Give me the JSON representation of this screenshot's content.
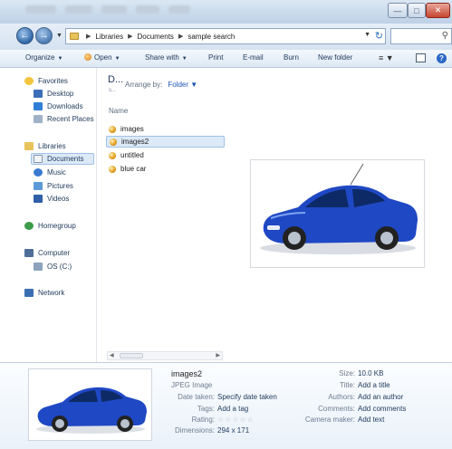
{
  "window": {
    "minimize_glyph": "—",
    "maximize_glyph": "□",
    "close_glyph": "✕"
  },
  "address": {
    "crumbs": [
      "Libraries",
      "Documents",
      "sample search"
    ],
    "search_placeholder": ""
  },
  "commands": {
    "organize": "Organize",
    "open": "Open",
    "share_with": "Share with",
    "print": "Print",
    "email": "E-mail",
    "burn": "Burn",
    "new_folder": "New folder"
  },
  "sidebar": {
    "favorites": {
      "label": "Favorites",
      "items": [
        "Desktop",
        "Downloads",
        "Recent Places"
      ]
    },
    "libraries": {
      "label": "Libraries",
      "items": [
        "Documents",
        "Music",
        "Pictures",
        "Videos"
      ]
    },
    "homegroup": "Homegroup",
    "computer": {
      "label": "Computer",
      "items": [
        "OS (C:)"
      ]
    },
    "network": "Network"
  },
  "library_pane": {
    "title": "D...",
    "subtitle": "s...",
    "arrange_label": "Arrange by:",
    "arrange_value": "Folder",
    "column_name": "Name",
    "files": [
      "images",
      "images2",
      "untitled",
      "blue car"
    ],
    "selected_index": 1
  },
  "details": {
    "file_name": "images2",
    "file_type": "JPEG Image",
    "date_taken_label": "Date taken:",
    "date_taken_value": "Specify date taken",
    "tags_label": "Tags:",
    "tags_value": "Add a tag",
    "rating_label": "Rating:",
    "rating_stars": "☆☆☆☆☆",
    "dimensions_label": "Dimensions:",
    "dimensions_value": "294 x 171",
    "size_label": "Size:",
    "size_value": "10.0 KB",
    "title_label": "Title:",
    "title_value": "Add a title",
    "authors_label": "Authors:",
    "authors_value": "Add an author",
    "comments_label": "Comments:",
    "comments_value": "Add comments",
    "camera_label": "Camera maker:",
    "camera_value": "Add text"
  },
  "colors": {
    "car_body": "#1f48c4",
    "selection": "#dce9f7",
    "link_blue": "#1a56b5"
  }
}
